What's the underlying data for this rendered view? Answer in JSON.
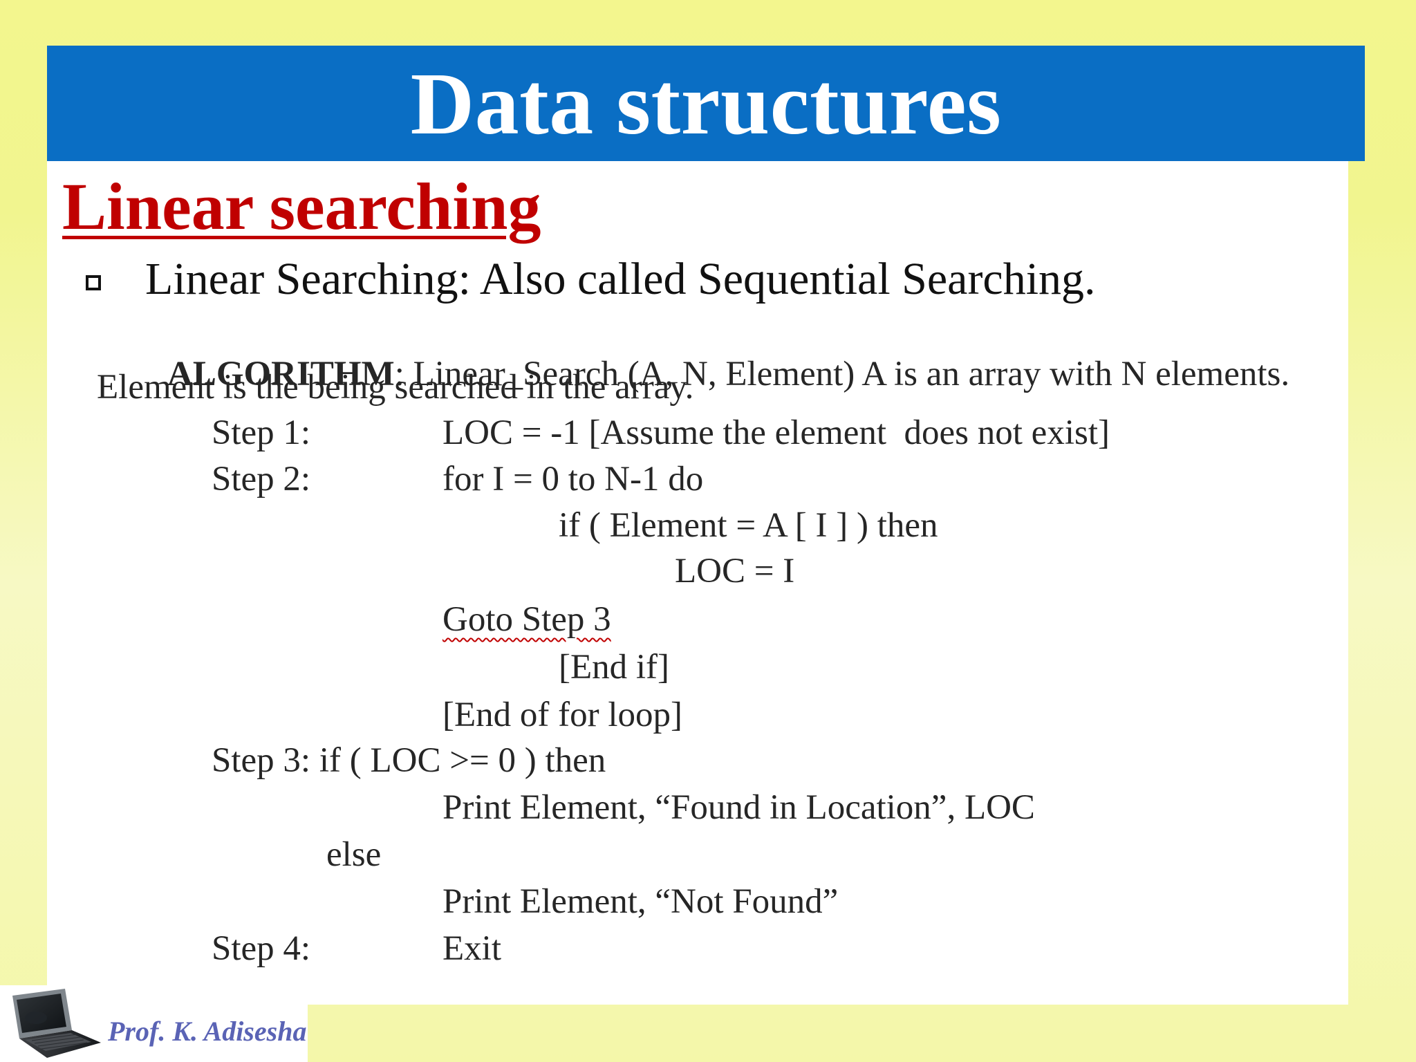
{
  "slide": {
    "title": "Data structures",
    "heading": "Linear searching",
    "bullet": "Linear Searching:  Also called Sequential Searching.",
    "algorithm": {
      "header_bold": "ALGORITHM",
      "header_rest": ": Linear_Search (A, N, Element) A is an array with N elements.",
      "line2": "Element is the being searched in the array.",
      "step1_label": "Step 1:",
      "step1_text": "LOC = -1 [Assume the element  does not exist]",
      "step2_label": "Step 2:",
      "step2_text": "for I = 0 to N-1 do",
      "if_line": "if ( Element = A [ I ] ) then",
      "loc_assign": "LOC = I",
      "goto": "Goto Step 3",
      "end_if": "[End if]",
      "end_for": "[End of for loop]",
      "step3": "Step 3: if ( LOC >= 0 ) then",
      "print_found": "Print Element, “Found in Location”, LOC",
      "else": "else",
      "print_not_found": "Print Element, “Not Found”",
      "step4_label": "Step 4:",
      "step4_text": "Exit"
    },
    "footer": {
      "author": "Prof. K. Adisesha",
      "logo_icon": "laptop-icon"
    }
  },
  "colors": {
    "title_bar": "#0a6ec4",
    "heading": "#c00000",
    "author": "#5a63b5"
  }
}
